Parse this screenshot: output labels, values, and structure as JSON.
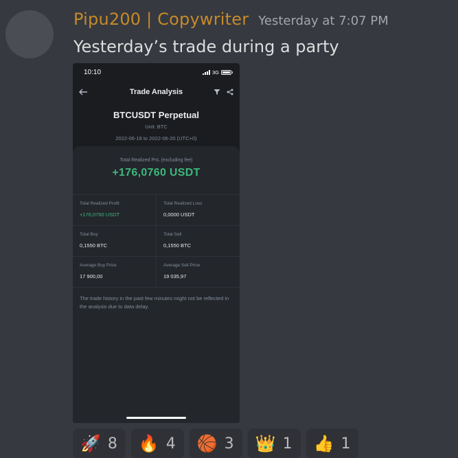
{
  "message": {
    "username": "Pipu200 | Copywriter",
    "timestamp": "Yesterday at 7:07 PM",
    "text": "Yesterday’s trade during a party"
  },
  "phone": {
    "status": {
      "time": "10:10",
      "network": "3G"
    },
    "nav": {
      "title": "Trade Analysis",
      "back_icon": "back-arrow-icon",
      "filter_icon": "filter-icon",
      "share_icon": "share-icon"
    },
    "pair": {
      "title": "BTCUSDT Perpetual",
      "unit": "Unit: BTC",
      "range": "2022-06-18 to 2022-06-20 (UTC+0)"
    },
    "pnl": {
      "label": "Total Realized PnL (excluding fee)",
      "value": "+176,0760 USDT"
    },
    "stats": [
      [
        {
          "label": "Total Realized Profit",
          "value": "+176,0760 USDT",
          "color": "#3cb87c"
        },
        {
          "label": "Total Realized Loss",
          "value": "0,0000 USDT"
        }
      ],
      [
        {
          "label": "Total Buy",
          "value": "0,1550 BTC"
        },
        {
          "label": "Total Sell",
          "value": "0,1550 BTC"
        }
      ],
      [
        {
          "label": "Average Buy Price",
          "value": "17 900,00"
        },
        {
          "label": "Average Sell Price",
          "value": "19 035,97"
        }
      ]
    ],
    "disclaimer": "The trade history in the past few minutes might not be reflected in the analysis due to data delay."
  },
  "reactions": [
    {
      "emoji": "🚀",
      "icon": "rocket-icon",
      "count": "8"
    },
    {
      "emoji": "🔥",
      "icon": "fire-icon",
      "count": "4"
    },
    {
      "emoji": "🏀",
      "icon": "basketball-icon",
      "count": "3"
    },
    {
      "emoji": "👑",
      "icon": "crown-icon",
      "count": "1"
    },
    {
      "emoji": "👍",
      "icon": "thumbs-up-icon",
      "count": "1"
    }
  ],
  "colors": {
    "background": "#36393f",
    "username": "#c68a2a",
    "profit_green": "#3cb87c"
  }
}
